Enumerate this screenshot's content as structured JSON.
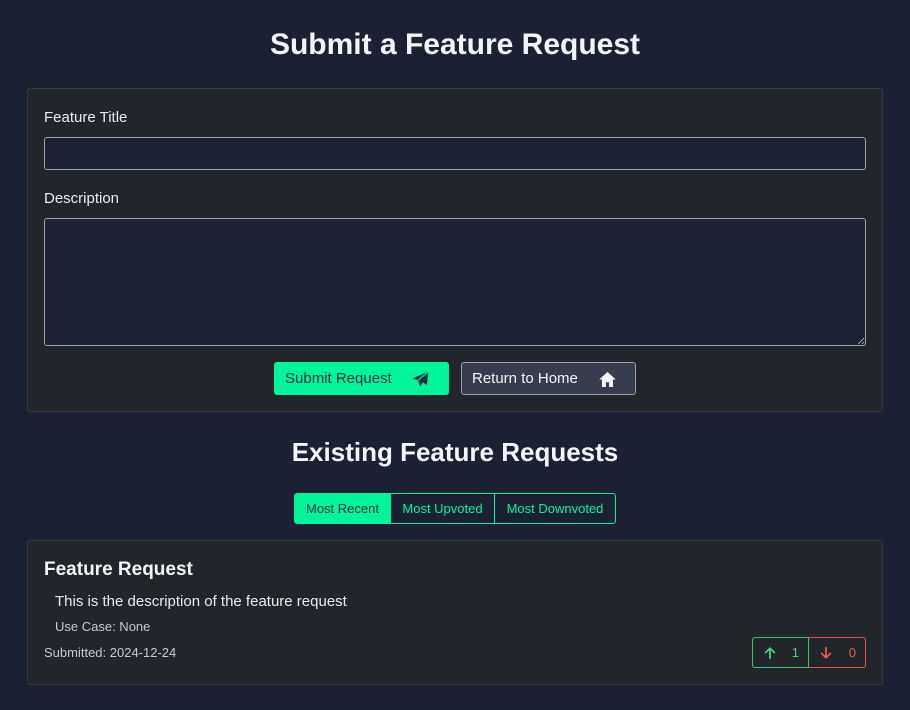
{
  "header": {
    "title": "Submit a Feature Request"
  },
  "form": {
    "title_label": "Feature Title",
    "title_value": "",
    "description_label": "Description",
    "description_value": "",
    "submit_label": "Submit Request",
    "home_label": "Return to Home",
    "submit_icon": "paper-plane-icon",
    "home_icon": "home-icon"
  },
  "existing": {
    "title": "Existing Feature Requests",
    "sort_options": [
      "Most Recent",
      "Most Upvoted",
      "Most Downvoted"
    ],
    "sort_selected": "Most Recent"
  },
  "requests": [
    {
      "title": "Feature Request",
      "description": "This is the description of the feature request",
      "use_case": "Use Case: None",
      "submitted": "Submitted: 2024-12-24",
      "upvotes": "1",
      "downvotes": "0"
    }
  ],
  "colors": {
    "background": "#1b2133",
    "card": "#22262b",
    "accent": "#00f59a",
    "upvote": "#55d07e",
    "downvote": "#ef5a55"
  }
}
